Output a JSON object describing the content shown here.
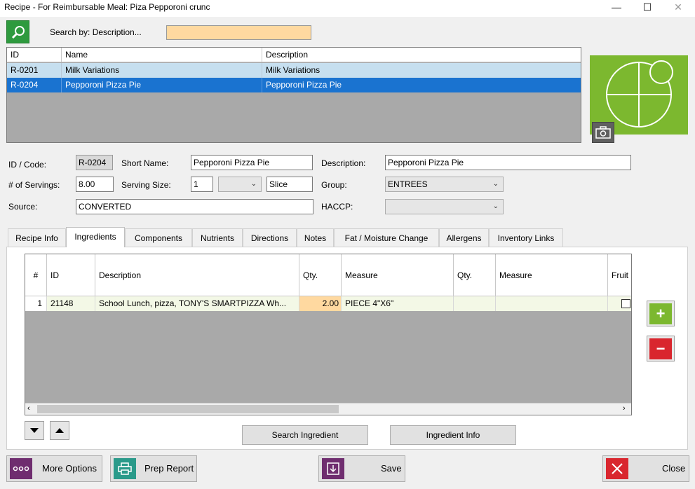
{
  "window": {
    "title": "Recipe - For Reimbursable Meal: Piza Pepporoni crunc",
    "minimize_glyph": "—",
    "maximize_glyph": "☐",
    "close_glyph": "✕"
  },
  "search": {
    "label": "Search by: Description...",
    "value": ""
  },
  "recipe_grid": {
    "columns": [
      "ID",
      "Name",
      "Description"
    ],
    "rows": [
      {
        "id": "R-0201",
        "name": "Milk Variations",
        "description": "Milk Variations"
      },
      {
        "id": "R-0204",
        "name": "Pepporoni Pizza Pie",
        "description": "Pepporoni Pizza Pie"
      }
    ]
  },
  "form": {
    "id_label": "ID / Code:",
    "id_value": "R-0204",
    "short_name_label": "Short Name:",
    "short_name_value": "Pepporoni Pizza Pie",
    "description_label": "Description:",
    "description_value": "Pepporoni Pizza Pie",
    "servings_label": "# of Servings:",
    "servings_value": "8.00",
    "serving_size_label": "Serving Size:",
    "serving_size_value": "1",
    "serving_unit_value": "",
    "serving_unit_text": "Slice",
    "group_label": "Group:",
    "group_value": "ENTREES",
    "source_label": "Source:",
    "source_value": "CONVERTED",
    "haccp_label": "HACCP:",
    "haccp_value": ""
  },
  "tabs": [
    {
      "label": "Recipe Info"
    },
    {
      "label": "Ingredients"
    },
    {
      "label": "Components"
    },
    {
      "label": "Nutrients"
    },
    {
      "label": "Directions"
    },
    {
      "label": "Notes"
    },
    {
      "label": "Fat / Moisture Change"
    },
    {
      "label": "Allergens"
    },
    {
      "label": "Inventory Links"
    }
  ],
  "ingredients": {
    "columns": [
      "#",
      "ID",
      "Description",
      "Qty.",
      "Measure",
      "Qty.",
      "Measure",
      "Fruit"
    ],
    "rows": [
      {
        "num": "1",
        "id": "21148",
        "description": "School Lunch, pizza, TONY'S SMARTPIZZA Wh...",
        "qty": "2.00",
        "measure": "PIECE 4\"X6\"",
        "qty2": "",
        "measure2": "",
        "fruit": false
      }
    ],
    "add_glyph": "+",
    "remove_glyph": "−",
    "search_ingredient_label": "Search Ingredient",
    "ingredient_info_label": "Ingredient Info"
  },
  "footer": {
    "more_options_label": "More Options",
    "prep_report_label": "Prep Report",
    "save_label": "Save",
    "close_label": "Close"
  },
  "colors": {
    "search_green": "#2e9a3e",
    "selection_blue": "#1a73d0",
    "alt_row": "#c6dfef",
    "image_green": "#7cb82f",
    "add_green": "#7cb82f",
    "remove_red": "#d9262e",
    "more_options_purple": "#6f2d6f",
    "prep_report_teal": "#2a9a8a",
    "save_purple": "#6f2d6f",
    "close_red": "#d9262e",
    "search_field": "#ffd9a0",
    "qty_cell": "#ffd9a0"
  },
  "icons": {
    "search": "magnifier-icon",
    "image_placeholder": "plate-icon",
    "camera": "camera-icon",
    "more_options": "ellipsis-icon",
    "prep_report": "printer-icon",
    "save": "save-icon",
    "close": "close-x-icon"
  }
}
